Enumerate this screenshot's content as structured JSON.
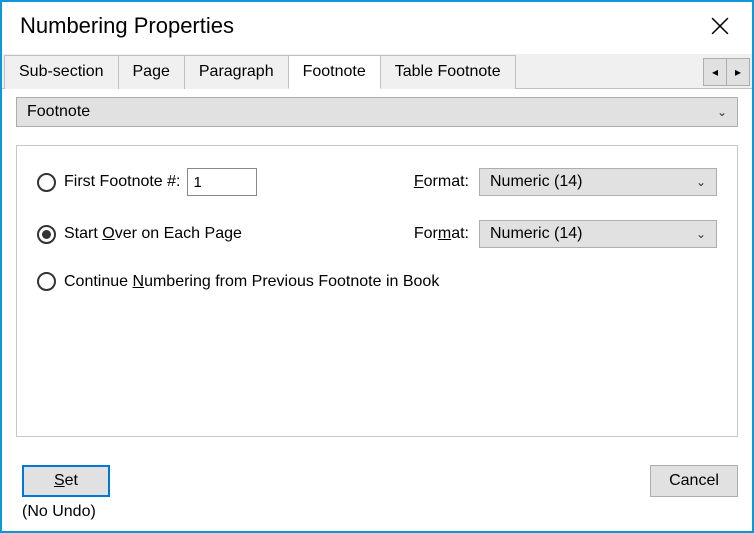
{
  "window": {
    "title": "Numbering Properties"
  },
  "tabs": {
    "items": [
      {
        "label": "Sub-section",
        "active": false
      },
      {
        "label": "Page",
        "active": false
      },
      {
        "label": "Paragraph",
        "active": false
      },
      {
        "label": "Footnote",
        "active": true
      },
      {
        "label": "Table Footnote",
        "active": false
      }
    ],
    "scroll_left": "◂",
    "scroll_right": "▸"
  },
  "section_dropdown": {
    "label": "Footnote"
  },
  "options": {
    "first": {
      "label_pre": "First Footnote #:",
      "value": "1"
    },
    "start_over": {
      "label_html": "Start <span class='underline'>O</span>ver on Each Page",
      "label_plain": "Start Over on Each Page"
    },
    "continue": {
      "label_html": "Continue <span class='underline'>N</span>umbering from Previous Footnote in Book",
      "label_plain": "Continue Numbering from Previous Footnote in Book"
    },
    "selected": "start_over"
  },
  "format1": {
    "label_html": "<span class='underline'>F</span>ormat:",
    "label_plain": "Format:",
    "value": "Numeric  (14)"
  },
  "format2": {
    "label_html": "For<span class='underline'>m</span>at:",
    "label_plain": "Format:",
    "value": "Numeric  (14)"
  },
  "buttons": {
    "set_html": "<span class='underline'>S</span>et",
    "set_plain": "Set",
    "cancel": "Cancel"
  },
  "hint": "(No Undo)"
}
